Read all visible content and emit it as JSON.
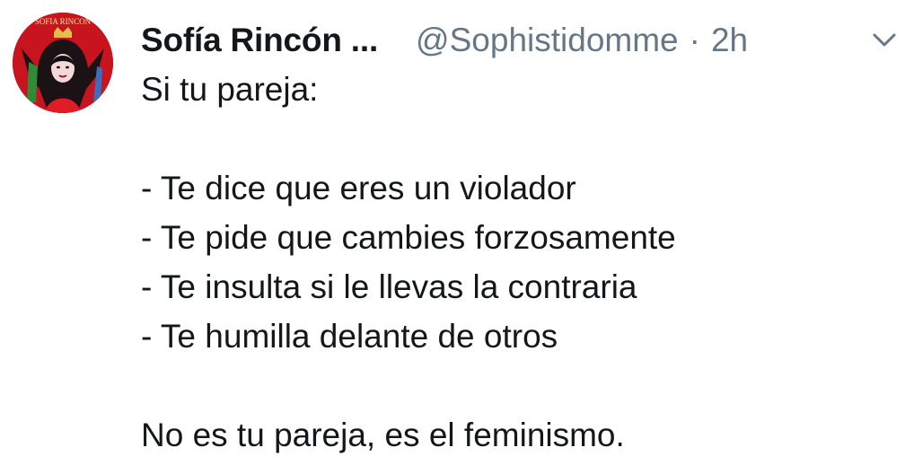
{
  "tweet": {
    "display_name": "Sofía Rincón ...",
    "handle": "@Sophistidomme",
    "separator": "·",
    "time": "2h",
    "avatar_text": "SOFIA RINCON",
    "lines": [
      "Si tu pareja:",
      "",
      "- Te dice que eres un violador",
      "- Te pide que cambies forzosamente",
      "- Te insulta si le llevas la contraria",
      "- Te humilla delante de otros",
      "",
      "No es tu pareja, es el feminismo."
    ]
  },
  "colors": {
    "text": "#14171a",
    "secondary": "#657786",
    "avatar_red": "#c8141e"
  },
  "icons": {
    "menu": "chevron-down-icon"
  }
}
